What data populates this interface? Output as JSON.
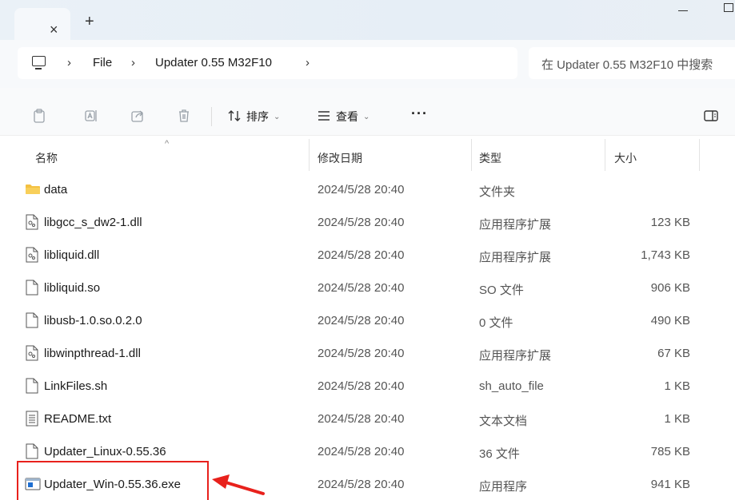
{
  "titlebar": {
    "tab_close": "×",
    "new_tab": "+"
  },
  "address": {
    "crumbs": [
      "File",
      "Updater 0.55 M32F10"
    ],
    "chevron": "›",
    "search_placeholder": "在 Updater 0.55 M32F10 中搜索"
  },
  "toolbar": {
    "sort_label": "排序",
    "view_label": "查看",
    "more": "···",
    "details_label": "详"
  },
  "columns": {
    "name": "名称",
    "date": "修改日期",
    "type": "类型",
    "size": "大小"
  },
  "files": [
    {
      "name": "data",
      "date": "2024/5/28 20:40",
      "type": "文件夹",
      "size": "",
      "icon": "folder-icon"
    },
    {
      "name": "libgcc_s_dw2-1.dll",
      "date": "2024/5/28 20:40",
      "type": "应用程序扩展",
      "size": "123 KB",
      "icon": "dll-file-icon"
    },
    {
      "name": "libliquid.dll",
      "date": "2024/5/28 20:40",
      "type": "应用程序扩展",
      "size": "1,743 KB",
      "icon": "dll-file-icon"
    },
    {
      "name": "libliquid.so",
      "date": "2024/5/28 20:40",
      "type": "SO 文件",
      "size": "906 KB",
      "icon": "blank-file-icon"
    },
    {
      "name": "libusb-1.0.so.0.2.0",
      "date": "2024/5/28 20:40",
      "type": "0 文件",
      "size": "490 KB",
      "icon": "blank-file-icon"
    },
    {
      "name": "libwinpthread-1.dll",
      "date": "2024/5/28 20:40",
      "type": "应用程序扩展",
      "size": "67 KB",
      "icon": "dll-file-icon"
    },
    {
      "name": "LinkFiles.sh",
      "date": "2024/5/28 20:40",
      "type": "sh_auto_file",
      "size": "1 KB",
      "icon": "blank-file-icon"
    },
    {
      "name": "README.txt",
      "date": "2024/5/28 20:40",
      "type": "文本文档",
      "size": "1 KB",
      "icon": "text-file-icon"
    },
    {
      "name": "Updater_Linux-0.55.36",
      "date": "2024/5/28 20:40",
      "type": "36 文件",
      "size": "785 KB",
      "icon": "blank-file-icon"
    },
    {
      "name": "Updater_Win-0.55.36.exe",
      "date": "2024/5/28 20:40",
      "type": "应用程序",
      "size": "941 KB",
      "icon": "exe-file-icon"
    }
  ],
  "colors": {
    "annotation": "#e8211c",
    "folder": "#f4c142",
    "exe_accent": "#1f6fd1"
  }
}
